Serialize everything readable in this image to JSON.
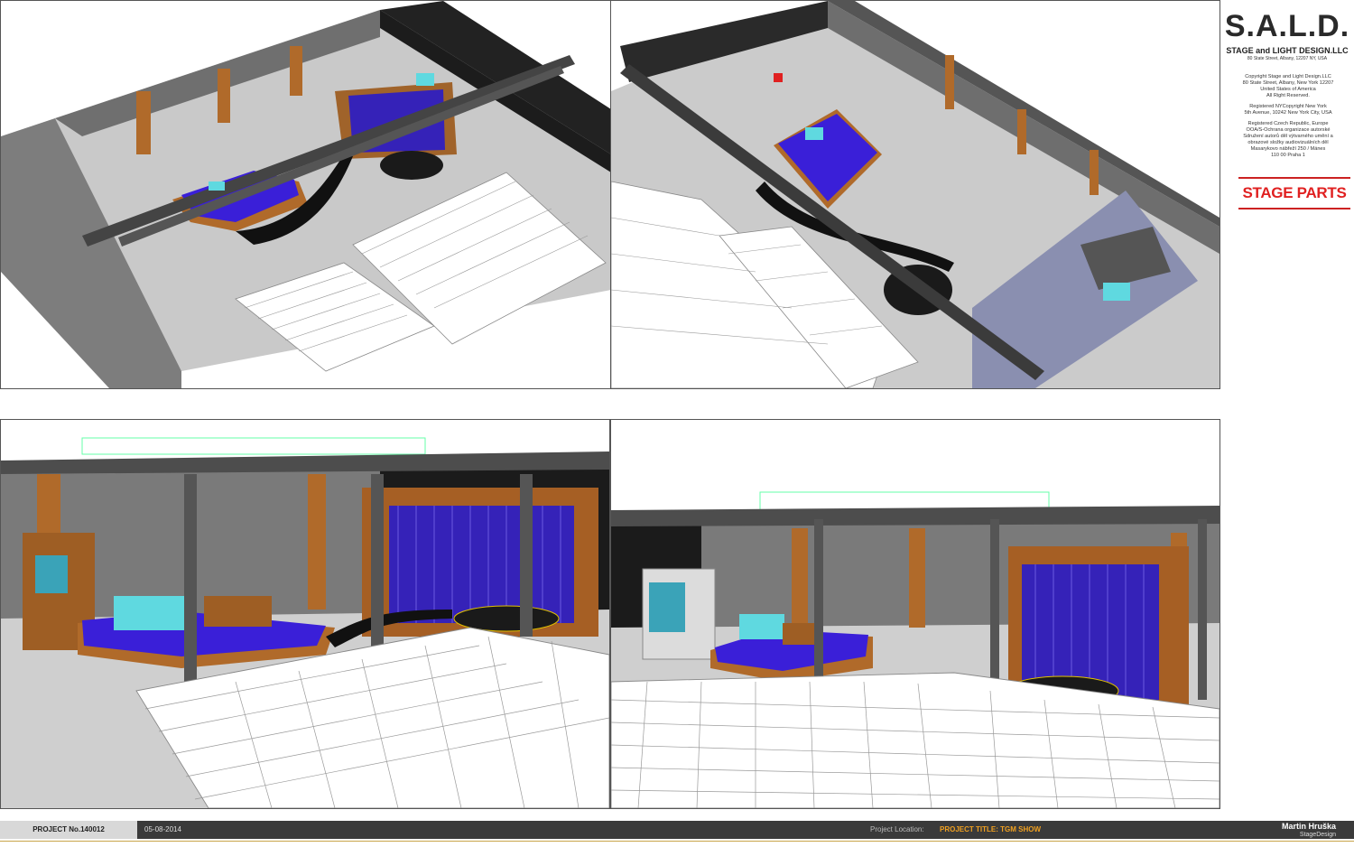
{
  "company": {
    "logo": "S.A.L.D.",
    "name": "STAGE and LIGHT DESIGN.LLC",
    "address": "80 State Street, Albany, 12207 NY, USA"
  },
  "copyright": [
    "Copyright Stage and Light Design.LLC\n80 State Street, Albany, New York 12207\nUnited States of America\nAll Right Reserved.",
    "Registered NYCopyright New York\n5th Avenue, 10242 New York City, USA",
    "Registered Czech Republic, Europe\nOOA/S-Ochrana organizace autorské\nSdružení autorů děl výtvarného umění a\nobrazové složky audiovizuálních děl\nMasarykovo nábřeží 250 / Mánes\n110 00 Praha 1"
  ],
  "sheet_title": "STAGE PARTS",
  "footer": {
    "project_no": "PROJECT No.140012",
    "date": "05-08-2014",
    "location_label": "Project Location:",
    "project_title": "PROJECT TITLE: TGM SHOW",
    "designer": "Martin Hruška",
    "designer_sub": "StageDesign"
  },
  "colors": {
    "stage_blue": "#3a1fd8",
    "wood": "#b06a2a",
    "floor": "#c9c9c9",
    "wall": "#7a7a7a",
    "sofa": "#5fd9e0",
    "accent": "#e02020"
  }
}
